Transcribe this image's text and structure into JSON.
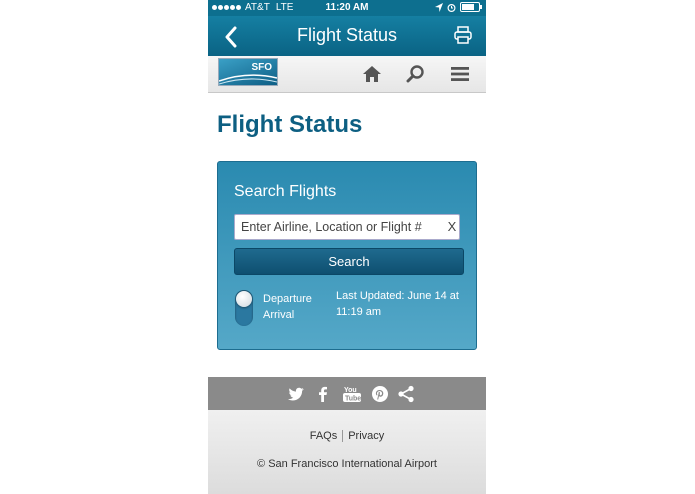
{
  "status_bar": {
    "carrier": "AT&T",
    "network": "LTE",
    "time": "11:20 AM"
  },
  "title_bar": {
    "back_icon": "chevron-left-icon",
    "title": "Flight Status",
    "print_icon": "printer-icon"
  },
  "nav_bar": {
    "logo_text": "SFO",
    "icons": [
      "home-icon",
      "search-icon",
      "menu-icon"
    ]
  },
  "page": {
    "title": "Flight Status"
  },
  "search": {
    "heading": "Search Flights",
    "placeholder": "Enter Airline, Location or Flight #",
    "value": "",
    "clear_label": "X",
    "button_label": "Search",
    "options": [
      "Departure",
      "Arrival"
    ],
    "selected_option": "Departure",
    "last_updated": "Last Updated: June 14 at 11:19 am"
  },
  "social": {
    "icons": [
      "twitter-icon",
      "facebook-icon",
      "youtube-icon",
      "pinterest-icon",
      "share-icon"
    ]
  },
  "footer": {
    "links": [
      "FAQs",
      "Privacy"
    ],
    "copyright": "© San Francisco International Airport"
  },
  "colors": {
    "brand_blue": "#0d5f82",
    "header_blue": "#157fa2",
    "panel_blue": "#2a8ab0",
    "social_gray": "#8a8a8a"
  }
}
